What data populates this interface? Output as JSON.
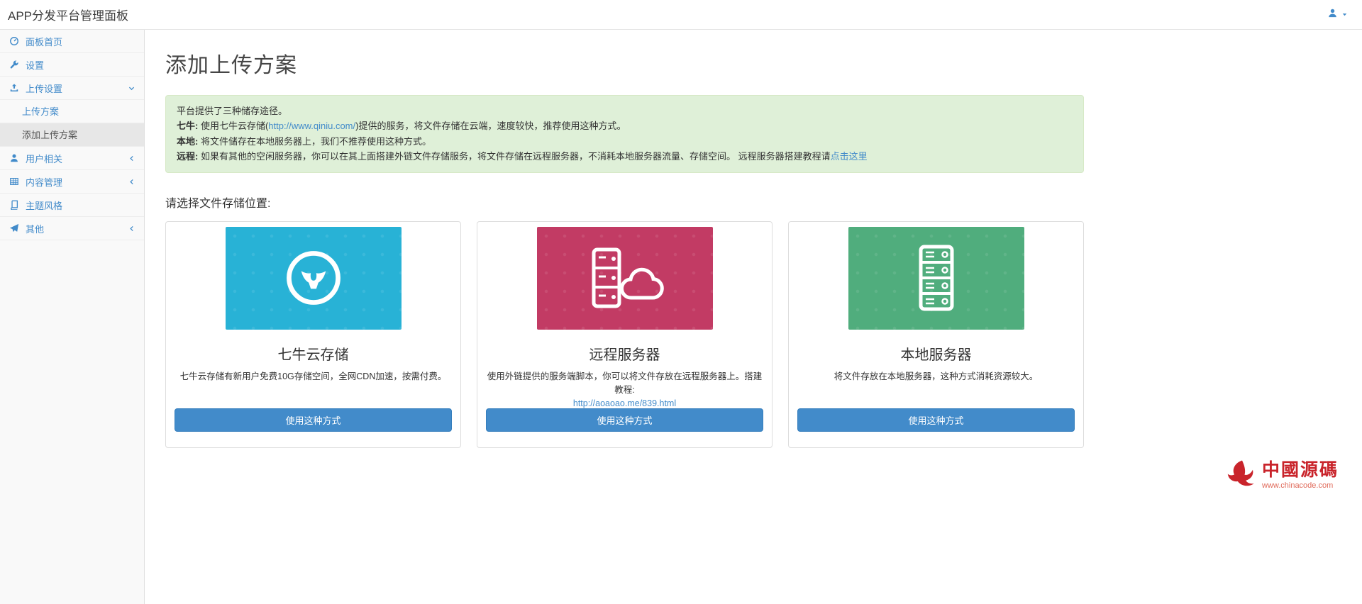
{
  "header": {
    "title": "APP分发平台管理面板"
  },
  "sidebar": {
    "items": [
      {
        "label": "面板首页"
      },
      {
        "label": "设置"
      },
      {
        "label": "上传设置"
      },
      {
        "label": "用户相关"
      },
      {
        "label": "内容管理"
      },
      {
        "label": "主题风格"
      },
      {
        "label": "其他"
      }
    ],
    "submenu": [
      {
        "label": "上传方案"
      },
      {
        "label": "添加上传方案"
      }
    ]
  },
  "main": {
    "page_title": "添加上传方案",
    "notice": {
      "intro": "平台提供了三种储存途径。",
      "qiniu_label": "七牛:",
      "qiniu_pre": " 使用七牛云存储(",
      "qiniu_link": "http://www.qiniu.com/",
      "qiniu_post": ")提供的服务，将文件存储在云端，速度较快，推荐使用这种方式。",
      "local_label": "本地:",
      "local_text": " 将文件储存在本地服务器上，我们不推荐使用这种方式。",
      "remote_label": "远程:",
      "remote_text": " 如果有其他的空闲服务器，你可以在其上面搭建外链文件存储服务，将文件存储在远程服务器，不消耗本地服务器流量、存储空间。 远程服务器搭建教程请",
      "remote_link": "点击这里"
    },
    "choose_label": "请选择文件存储位置:",
    "cards": [
      {
        "title": "七牛云存储",
        "description": "七牛云存储有新用户免费10G存储空间，全网CDN加速，按需付费。",
        "button": "使用这种方式",
        "color": "#28b2d6"
      },
      {
        "title": "远程服务器",
        "description": "使用外链提供的服务端脚本，你可以将文件存放在远程服务器上。搭建教程:",
        "link": "http://aoaoao.me/839.html",
        "button": "使用这种方式",
        "color": "#c23b64"
      },
      {
        "title": "本地服务器",
        "description": "将文件存放在本地服务器，这种方式消耗资源较大。",
        "button": "使用这种方式",
        "color": "#50ad7d"
      }
    ]
  },
  "colors": {
    "accent": "#428bca",
    "alert_bg": "#dff0d8",
    "alert_border": "#d6e9c6"
  },
  "watermark": {
    "name": "中國源碼",
    "url": "www.chinacode.com"
  }
}
